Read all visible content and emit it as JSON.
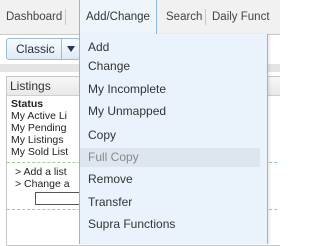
{
  "tabs": [
    {
      "label": "Dashboard"
    },
    {
      "label": "Add/Change",
      "active": true
    },
    {
      "label": "Search"
    },
    {
      "label": "Daily Funct"
    }
  ],
  "view_selector": {
    "selected": "Classic"
  },
  "listings_panel": {
    "title": "Listings",
    "status_heading": "Status",
    "links": [
      "My Active Li",
      "My Pending",
      "My Listings",
      "My Sold List"
    ],
    "actions": [
      "> Add a list",
      "> Change a"
    ]
  },
  "menu": {
    "items": [
      "Add",
      "Change",
      "My Incomplete",
      "My Unmapped",
      "Copy",
      "Full Copy",
      "Remove",
      "Transfer",
      "Supra Functions"
    ],
    "highlighted_index": 5
  },
  "colors": {
    "menu_bg": "#eaf3fb",
    "menu_border": "#8bb8dd",
    "highlight_bg": "#dde6ee"
  }
}
